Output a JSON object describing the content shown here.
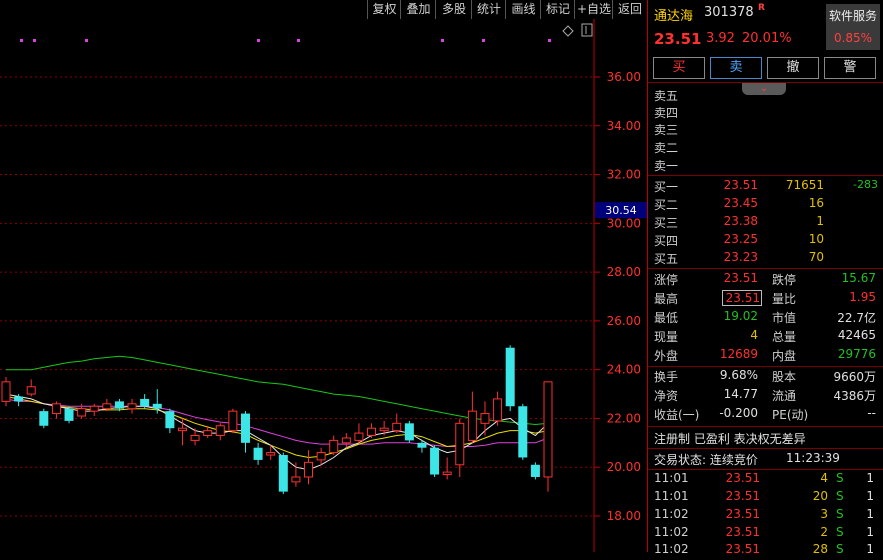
{
  "toolbar": [
    "复权",
    "叠加",
    "多股",
    "统计",
    "画线",
    "标记",
    "+自选",
    "返回"
  ],
  "chart": {
    "price_ticks": [
      "36.00",
      "34.00",
      "32.00",
      "30.00",
      "28.00",
      "26.00",
      "24.00",
      "22.00",
      "20.00",
      "18.00"
    ],
    "cursor_price": "30.54",
    "candles": [
      {
        "o": 22.7,
        "c": 23.5,
        "h": 23.7,
        "l": 22.5
      },
      {
        "o": 22.9,
        "c": 22.7,
        "h": 23.0,
        "l": 22.5
      },
      {
        "o": 23.0,
        "c": 23.3,
        "h": 23.6,
        "l": 22.9
      },
      {
        "o": 22.3,
        "c": 21.7,
        "h": 22.4,
        "l": 21.6
      },
      {
        "o": 22.2,
        "c": 22.6,
        "h": 22.7,
        "l": 22.0
      },
      {
        "o": 22.4,
        "c": 21.9,
        "h": 22.5,
        "l": 21.8
      },
      {
        "o": 22.1,
        "c": 22.4,
        "h": 22.6,
        "l": 22.0
      },
      {
        "o": 22.3,
        "c": 22.5,
        "h": 22.6,
        "l": 22.1
      },
      {
        "o": 22.4,
        "c": 22.6,
        "h": 22.8,
        "l": 22.3
      },
      {
        "o": 22.7,
        "c": 22.4,
        "h": 22.8,
        "l": 22.3
      },
      {
        "o": 22.4,
        "c": 22.6,
        "h": 22.8,
        "l": 22.2
      },
      {
        "o": 22.8,
        "c": 22.5,
        "h": 23.0,
        "l": 22.4
      },
      {
        "o": 22.6,
        "c": 22.4,
        "h": 23.2,
        "l": 22.2
      },
      {
        "o": 22.3,
        "c": 21.6,
        "h": 22.4,
        "l": 21.4
      },
      {
        "o": 21.5,
        "c": 21.6,
        "h": 22.0,
        "l": 20.9
      },
      {
        "o": 21.1,
        "c": 21.3,
        "h": 21.6,
        "l": 20.9
      },
      {
        "o": 21.3,
        "c": 21.5,
        "h": 21.7,
        "l": 21.2
      },
      {
        "o": 21.3,
        "c": 21.7,
        "h": 21.8,
        "l": 21.1
      },
      {
        "o": 21.5,
        "c": 22.3,
        "h": 22.4,
        "l": 21.4
      },
      {
        "o": 22.2,
        "c": 21.0,
        "h": 22.3,
        "l": 20.6
      },
      {
        "o": 20.8,
        "c": 20.3,
        "h": 21.0,
        "l": 20.1
      },
      {
        "o": 20.5,
        "c": 20.6,
        "h": 20.9,
        "l": 20.3
      },
      {
        "o": 20.5,
        "c": 19.0,
        "h": 20.6,
        "l": 18.9
      },
      {
        "o": 19.4,
        "c": 19.6,
        "h": 20.2,
        "l": 19.2
      },
      {
        "o": 19.6,
        "c": 20.2,
        "h": 20.7,
        "l": 19.3
      },
      {
        "o": 20.3,
        "c": 20.6,
        "h": 20.8,
        "l": 20.1
      },
      {
        "o": 20.6,
        "c": 21.1,
        "h": 21.3,
        "l": 20.5
      },
      {
        "o": 21.0,
        "c": 21.2,
        "h": 21.4,
        "l": 20.8
      },
      {
        "o": 21.1,
        "c": 21.4,
        "h": 21.8,
        "l": 21.0
      },
      {
        "o": 21.3,
        "c": 21.6,
        "h": 21.8,
        "l": 21.2
      },
      {
        "o": 21.5,
        "c": 21.6,
        "h": 21.9,
        "l": 21.3
      },
      {
        "o": 21.5,
        "c": 21.8,
        "h": 22.2,
        "l": 21.4
      },
      {
        "o": 21.8,
        "c": 21.1,
        "h": 21.9,
        "l": 21.0
      },
      {
        "o": 21.0,
        "c": 20.8,
        "h": 21.1,
        "l": 20.6
      },
      {
        "o": 20.8,
        "c": 19.7,
        "h": 20.9,
        "l": 19.6
      },
      {
        "o": 19.7,
        "c": 19.8,
        "h": 20.4,
        "l": 19.5
      },
      {
        "o": 20.1,
        "c": 21.8,
        "h": 22.0,
        "l": 19.6
      },
      {
        "o": 21.1,
        "c": 22.3,
        "h": 23.1,
        "l": 21.0
      },
      {
        "o": 21.8,
        "c": 22.2,
        "h": 22.7,
        "l": 21.3
      },
      {
        "o": 21.9,
        "c": 22.8,
        "h": 23.1,
        "l": 21.7
      },
      {
        "o": 24.9,
        "c": 22.5,
        "h": 25.0,
        "l": 22.3
      },
      {
        "o": 22.5,
        "c": 20.4,
        "h": 22.6,
        "l": 20.3
      },
      {
        "o": 20.1,
        "c": 19.6,
        "h": 20.2,
        "l": 19.5
      },
      {
        "o": 19.6,
        "c": 23.5,
        "h": 23.5,
        "l": 19.0
      }
    ],
    "ma_green": [
      24.0,
      24.0,
      24.0,
      24.1,
      24.2,
      24.3,
      24.35,
      24.45,
      24.5,
      24.55,
      24.5,
      24.4,
      24.3,
      24.2,
      24.1,
      24.0,
      23.9,
      23.8,
      23.7,
      23.6,
      23.5,
      23.45,
      23.4,
      23.3,
      23.2,
      23.1,
      23.0,
      22.95,
      22.9,
      22.8,
      22.7,
      22.6,
      22.5,
      22.4,
      22.3,
      22.2,
      22.1,
      22.0,
      21.95,
      21.9,
      21.85,
      21.8,
      21.75,
      21.8
    ],
    "ma_magenta": [
      22.8,
      22.7,
      22.7,
      22.6,
      22.55,
      22.5,
      22.5,
      22.5,
      22.5,
      22.5,
      22.5,
      22.5,
      22.45,
      22.35,
      22.2,
      22.05,
      21.95,
      21.85,
      21.8,
      21.7,
      21.55,
      21.4,
      21.25,
      21.1,
      21.0,
      20.95,
      20.95,
      20.95,
      20.95,
      20.95,
      21.0,
      21.0,
      21.0,
      20.95,
      20.9,
      20.85,
      20.85,
      20.85,
      20.9,
      21.0,
      21.0,
      21.0,
      21.0,
      21.2
    ],
    "ma_yellow": [
      22.9,
      22.8,
      22.7,
      22.6,
      22.5,
      22.45,
      22.4,
      22.35,
      22.35,
      22.35,
      22.4,
      22.4,
      22.35,
      22.2,
      22.0,
      21.8,
      21.65,
      21.5,
      21.45,
      21.35,
      21.1,
      20.9,
      20.7,
      20.5,
      20.4,
      20.45,
      20.6,
      20.75,
      20.95,
      21.1,
      21.2,
      21.3,
      21.35,
      21.25,
      21.05,
      20.85,
      20.9,
      21.0,
      21.2,
      21.4,
      21.5,
      21.5,
      21.4,
      21.5
    ],
    "ma_white": [
      23.0,
      22.9,
      22.8,
      22.6,
      22.5,
      22.4,
      22.3,
      22.3,
      22.4,
      22.45,
      22.5,
      22.5,
      22.4,
      22.1,
      21.8,
      21.5,
      21.4,
      21.4,
      21.5,
      21.5,
      21.2,
      20.9,
      20.4,
      20.0,
      19.9,
      20.1,
      20.4,
      20.8,
      21.0,
      21.3,
      21.4,
      21.5,
      21.4,
      21.1,
      20.8,
      20.6,
      20.7,
      21.0,
      21.5,
      21.9,
      22.0,
      21.6,
      21.3,
      21.8
    ],
    "dots": [
      0,
      1,
      2,
      3,
      4,
      5,
      6
    ]
  },
  "stock": {
    "name": "通达海",
    "code": "301378",
    "badge": "R",
    "price": "23.51",
    "change": "3.92",
    "change_pct": "20.01%",
    "service_label": "软件服务",
    "service_pct": "0.85%"
  },
  "trade_buttons": [
    "买",
    "卖",
    "撤",
    "警"
  ],
  "sell_levels": [
    "卖五",
    "卖四",
    "卖三",
    "卖二",
    "卖一"
  ],
  "buy_levels": [
    {
      "label": "买一",
      "price": "23.51",
      "vol": "71651",
      "chg": "-283"
    },
    {
      "label": "买二",
      "price": "23.45",
      "vol": "16",
      "chg": ""
    },
    {
      "label": "买三",
      "price": "23.38",
      "vol": "1",
      "chg": ""
    },
    {
      "label": "买四",
      "price": "23.25",
      "vol": "10",
      "chg": ""
    },
    {
      "label": "买五",
      "price": "23.23",
      "vol": "70",
      "chg": ""
    }
  ],
  "stats1": [
    {
      "l1": "涨停",
      "v1": "23.51",
      "c1": "red",
      "l2": "跌停",
      "v2": "15.67",
      "c2": "grn"
    },
    {
      "l1": "最高",
      "v1": "23.51",
      "c1": "red",
      "l2": "量比",
      "v2": "1.95",
      "c2": "red"
    },
    {
      "l1": "最低",
      "v1": "19.02",
      "c1": "grn",
      "l2": "市值",
      "v2": "22.7亿",
      "c2": "wht"
    },
    {
      "l1": "现量",
      "v1": "4",
      "c1": "yel",
      "l2": "总量",
      "v2": "42465",
      "c2": "wht"
    },
    {
      "l1": "外盘",
      "v1": "12689",
      "c1": "red",
      "l2": "内盘",
      "v2": "29776",
      "c2": "grn"
    }
  ],
  "stats2": [
    {
      "l1": "换手",
      "v1": "9.68%",
      "l2": "股本",
      "v2": "9660万"
    },
    {
      "l1": "净资",
      "v1": "14.77",
      "l2": "流通",
      "v2": "4386万"
    },
    {
      "l1": "收益(一)",
      "v1": "-0.200",
      "l2": "PE(动)",
      "v2": "--"
    }
  ],
  "registration": "注册制 已盈利 表决权无差异",
  "trade_status_label": "交易状态: 连续竞价",
  "trade_status_time": "11:23:39",
  "ticks": [
    {
      "time": "11:01",
      "price": "23.51",
      "vol": "4",
      "side": "S",
      "n": "1"
    },
    {
      "time": "11:01",
      "price": "23.51",
      "vol": "20",
      "side": "S",
      "n": "1"
    },
    {
      "time": "11:02",
      "price": "23.51",
      "vol": "3",
      "side": "S",
      "n": "1"
    },
    {
      "time": "11:02",
      "price": "23.51",
      "vol": "2",
      "side": "S",
      "n": "1"
    },
    {
      "time": "11:02",
      "price": "23.51",
      "vol": "28",
      "side": "S",
      "n": "1"
    }
  ]
}
